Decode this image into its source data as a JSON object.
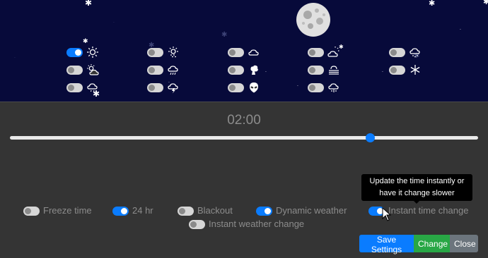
{
  "time": {
    "display": "02:00",
    "fraction": 0.77
  },
  "weather_options": [
    {
      "icon": "sun-icon",
      "on": true
    },
    {
      "icon": "sun-haze-icon",
      "on": false
    },
    {
      "icon": "cloudy-icon",
      "on": false
    },
    {
      "icon": "partly-cloudy-icon",
      "on": false
    },
    {
      "icon": "snow-cloud-icon",
      "on": false
    },
    {
      "icon": "sun-cloud-icon",
      "on": false
    },
    {
      "icon": "rain-cloud-icon",
      "on": false
    },
    {
      "icon": "smoke-icon",
      "on": false
    },
    {
      "icon": "fog-icon",
      "on": false
    },
    {
      "icon": "snowflake-icon",
      "on": false
    },
    {
      "icon": "light-rain-cloud-icon",
      "on": false
    },
    {
      "icon": "thunderstorm-icon",
      "on": false
    },
    {
      "icon": "alien-icon",
      "on": false
    },
    {
      "icon": "hail-cloud-icon",
      "on": false
    }
  ],
  "options": {
    "freeze_time": {
      "label": "Freeze time",
      "on": false
    },
    "hr24": {
      "label": "24 hr",
      "on": true
    },
    "blackout": {
      "label": "Blackout",
      "on": false
    },
    "dynamic_weather": {
      "label": "Dynamic weather",
      "on": true
    },
    "instant_time_change": {
      "label": "Instant time change",
      "on": true
    },
    "instant_weather_change": {
      "label": "Instant weather change",
      "on": false
    }
  },
  "tooltip": {
    "line1": "Update the time instantly or",
    "line2": "have it change slower"
  },
  "buttons": {
    "save": "Save Settings",
    "change": "Change",
    "close": "Close"
  },
  "colors": {
    "sky": "#070a3a",
    "panel": "#343434",
    "accent": "#0a7cff",
    "success": "#28a745",
    "secondary": "#6c757d"
  }
}
